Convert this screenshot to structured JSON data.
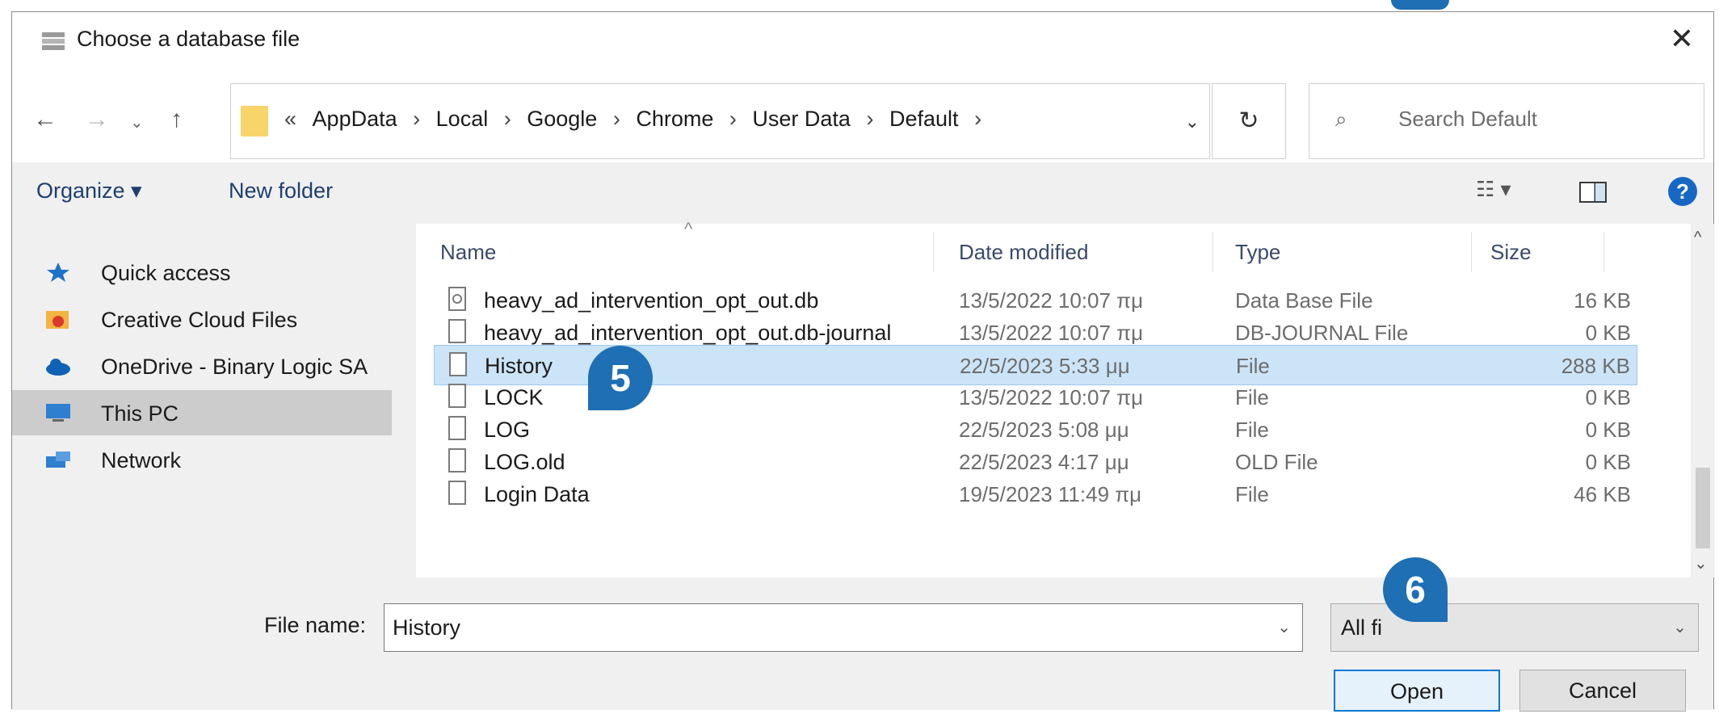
{
  "window": {
    "title": "Choose a database file",
    "close_glyph": "✕"
  },
  "nav": {
    "back_glyph": "←",
    "forward_glyph": "→",
    "recent_glyph": "⌄",
    "up_glyph": "↑",
    "breadcrumb_prefix": "«",
    "path": [
      "AppData",
      "Local",
      "Google",
      "Chrome",
      "User Data",
      "Default"
    ],
    "separator": "›",
    "dropdown_glyph": "⌄",
    "refresh_glyph": "↻",
    "search_placeholder": "Search Default",
    "search_glyph": "⌕"
  },
  "toolbar": {
    "organize_label": "Organize ▾",
    "new_folder_label": "New folder",
    "view_glyph": "☷ ▾",
    "help_glyph": "?"
  },
  "sidebar": {
    "items": [
      {
        "label": "Quick access",
        "icon": "star-icon",
        "color": "#1e72c8"
      },
      {
        "label": "Creative Cloud Files",
        "icon": "creative-cloud-icon",
        "color": "#f0a030"
      },
      {
        "label": "OneDrive - Binary Logic SA",
        "icon": "cloud-icon",
        "color": "#0f62b5"
      },
      {
        "label": "This PC",
        "icon": "computer-icon",
        "color": "#2f7fd0"
      },
      {
        "label": "Network",
        "icon": "network-icon",
        "color": "#2f7fd0"
      }
    ],
    "selected_index": 3
  },
  "filelist": {
    "columns": {
      "name": "Name",
      "date": "Date modified",
      "type": "Type",
      "size": "Size"
    },
    "sort_glyph": "^",
    "rows": [
      {
        "name": "heavy_ad_intervention_opt_out.db",
        "date": "13/5/2022 10:07 πμ",
        "type": "Data Base File",
        "size": "16 KB"
      },
      {
        "name": "heavy_ad_intervention_opt_out.db-journal",
        "date": "13/5/2022 10:07 πμ",
        "type": "DB-JOURNAL File",
        "size": "0 KB"
      },
      {
        "name": "History",
        "date": "22/5/2023 5:33 μμ",
        "type": "File",
        "size": "288 KB"
      },
      {
        "name": "LOCK",
        "date": "13/5/2022 10:07 πμ",
        "type": "File",
        "size": "0 KB"
      },
      {
        "name": "LOG",
        "date": "22/5/2023 5:08 μμ",
        "type": "File",
        "size": "0 KB"
      },
      {
        "name": "LOG.old",
        "date": "22/5/2023 4:17 μμ",
        "type": "OLD File",
        "size": "0 KB"
      },
      {
        "name": "Login Data",
        "date": "19/5/2023 11:49 πμ",
        "type": "File",
        "size": "46 KB"
      }
    ],
    "selected_index": 2,
    "scroll_up_glyph": "^",
    "scroll_down_glyph": "⌄"
  },
  "footer": {
    "file_name_label": "File name:",
    "file_name_value": "History",
    "dropdown_glyph": "⌄",
    "filter_value": "All fi",
    "open_label": "Open",
    "cancel_label": "Cancel"
  },
  "callouts": {
    "step5": "5",
    "step6": "6",
    "color": "#1e6fb4"
  }
}
